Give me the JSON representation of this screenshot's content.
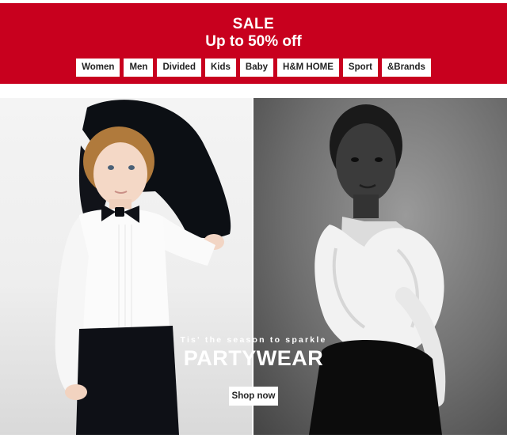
{
  "banner": {
    "title": "SALE",
    "subtitle": "Up to 50% off",
    "background": "#c8001e",
    "categories": [
      "Women",
      "Men",
      "Divided",
      "Kids",
      "Baby",
      "H&M HOME",
      "Sport",
      "&Brands"
    ]
  },
  "hero": {
    "tagline": "Tis' the season to sparkle",
    "headline": "PARTYWEAR",
    "cta_label": "Shop now",
    "left_image": "boy-in-white-shirt-bow-tie-holding-jacket-photo",
    "right_image": "girl-in-white-fur-bw-photo"
  }
}
